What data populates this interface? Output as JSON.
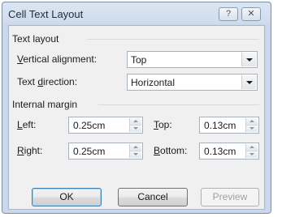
{
  "window": {
    "title": "Cell Text Layout",
    "help_glyph": "?",
    "close_glyph": "✕"
  },
  "text_layout": {
    "group_label": "Text layout",
    "vertical_alignment": {
      "label_key": "V",
      "label_rest": "ertical alignment:",
      "value": "Top"
    },
    "text_direction": {
      "label_pre": "Text ",
      "label_key": "d",
      "label_rest": "irection:",
      "value": "Horizontal"
    }
  },
  "internal_margin": {
    "group_label": "Internal margin",
    "left": {
      "label_key": "L",
      "label_rest": "eft:",
      "value": "0.25cm"
    },
    "right": {
      "label_key": "R",
      "label_rest": "ight:",
      "value": "0.25cm"
    },
    "top": {
      "label_key": "T",
      "label_rest": "op:",
      "value": "0.13cm"
    },
    "bottom": {
      "label_key": "B",
      "label_rest": "ottom:",
      "value": "0.13cm"
    }
  },
  "buttons": {
    "ok": "OK",
    "cancel": "Cancel",
    "preview": "Preview"
  }
}
